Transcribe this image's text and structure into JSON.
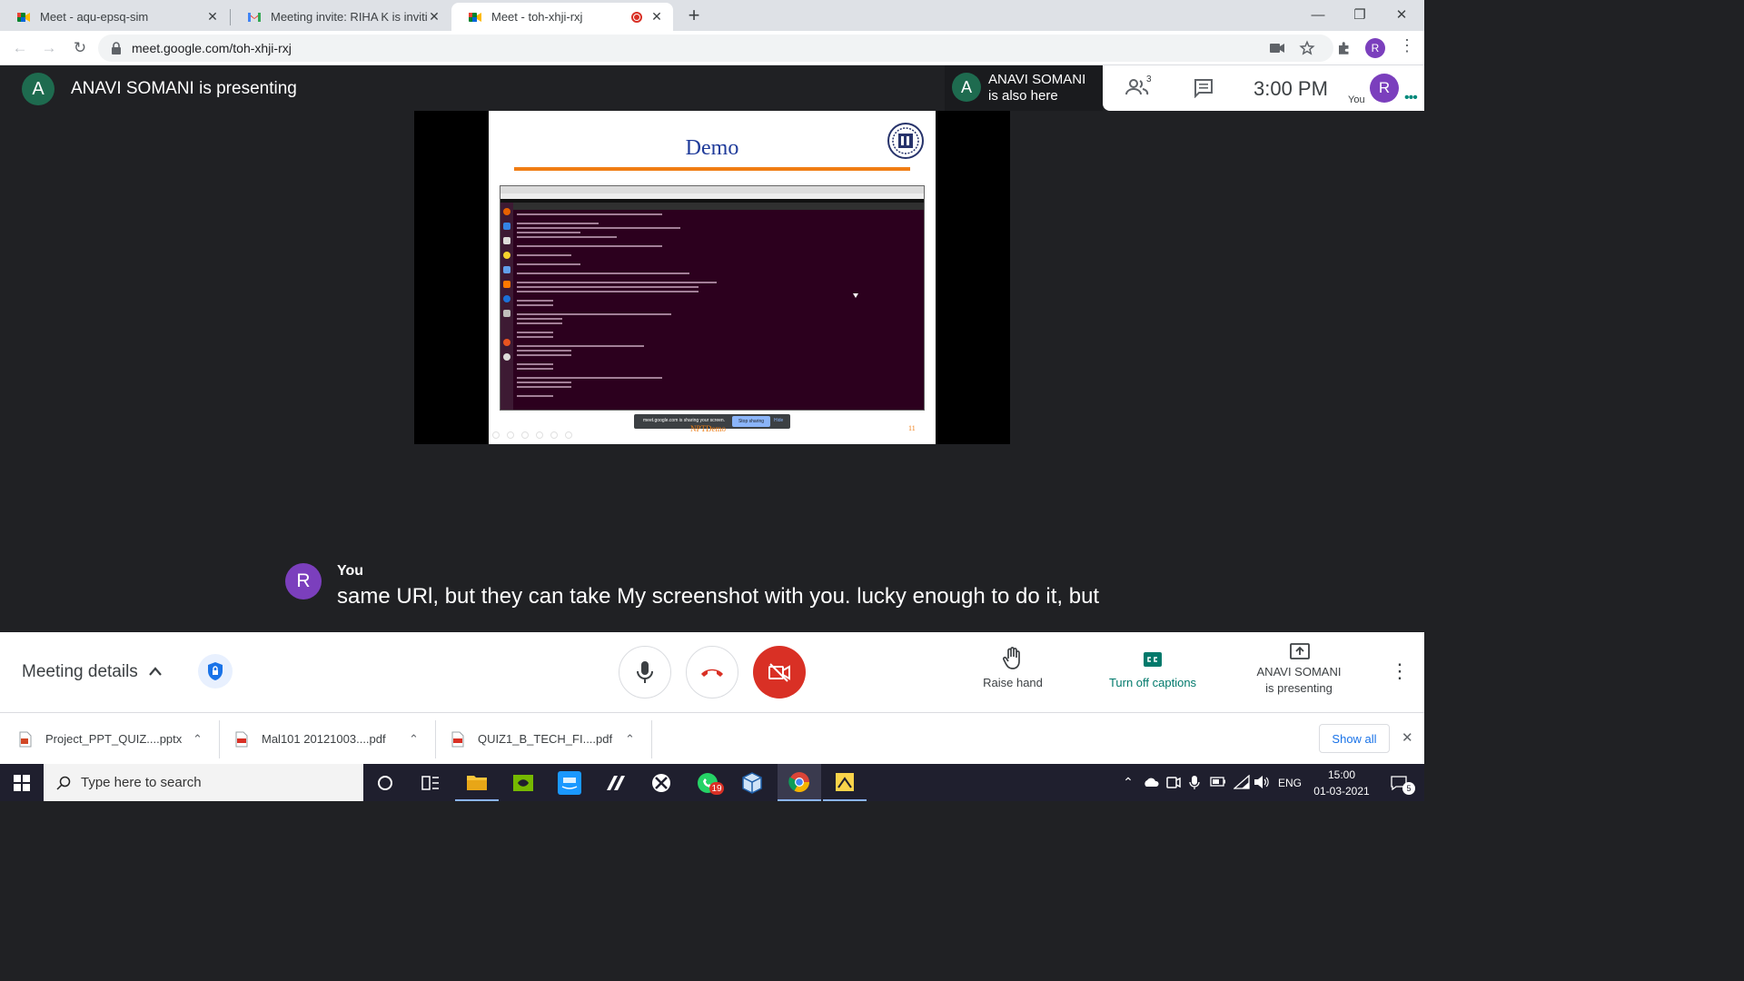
{
  "browser": {
    "tabs": [
      {
        "title": "Meet - aqu-epsq-sim",
        "icon": "google-meet-icon"
      },
      {
        "title": "Meeting invite: RIHA K is inviting",
        "icon": "gmail-icon"
      },
      {
        "title": "Meet - toh-xhji-rxj",
        "icon": "google-meet-icon",
        "recording": true
      }
    ],
    "new_tab_symbol": "+",
    "url": "meet.google.com/toh-xhji-rxj",
    "profile_initial": "R"
  },
  "meet": {
    "presenter_initial": "A",
    "presenter_banner": "ANAVI SOMANI is presenting",
    "also_here_name": "ANAVI SOMANI",
    "also_here_status": "is also here",
    "participant_count": "3",
    "clock": "3:00 PM",
    "self_label": "You",
    "self_initial": "R",
    "slide": {
      "title": "Demo",
      "page_number": "11",
      "footer": "NPTDemo",
      "share_bar_text": "meet.google.com is sharing your screen.",
      "stop_sharing": "Stop sharing",
      "hide": "Hide"
    },
    "caption": {
      "speaker_initial": "R",
      "speaker": "You",
      "text": "same URl, but they can take My screenshot with you. lucky enough to do it, but"
    },
    "controls": {
      "meeting_details": "Meeting details",
      "raise_hand": "Raise hand",
      "captions": "Turn off captions",
      "presenting_line1": "ANAVI SOMANI",
      "presenting_line2": "is presenting"
    }
  },
  "downloads": {
    "items": [
      {
        "name": "Project_PPT_QUIZ....pptx",
        "icon": "pptx-file-icon"
      },
      {
        "name": "Mal101 20121003....pdf",
        "icon": "pdf-file-icon"
      },
      {
        "name": "QUIZ1_B_TECH_FI....pdf",
        "icon": "pdf-file-icon"
      }
    ],
    "show_all": "Show all"
  },
  "taskbar": {
    "search_placeholder": "Type here to search",
    "whatsapp_badge": "19",
    "language": "ENG",
    "time": "15:00",
    "date": "01-03-2021",
    "notification_count": "5"
  },
  "colors": {
    "meet_bg": "#202124",
    "end_call_red": "#d93025",
    "captions_green": "#00796b",
    "slide_title_blue": "#1f3b9a",
    "slide_rule_orange": "#f07d14",
    "terminal_bg": "#2c001e"
  }
}
